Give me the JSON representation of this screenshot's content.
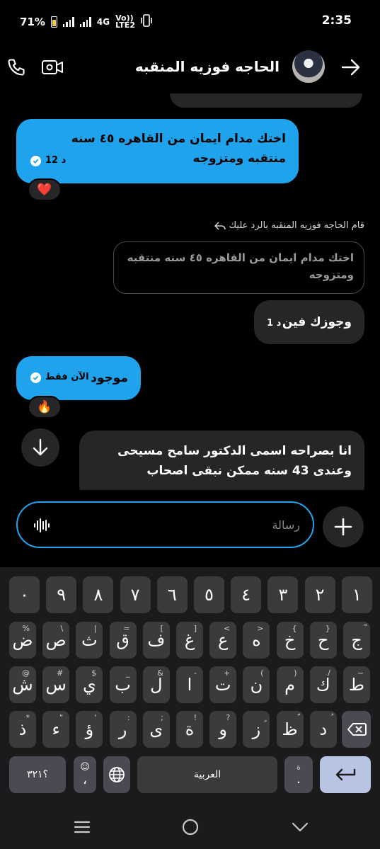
{
  "status_bar": {
    "battery": "71%",
    "network_label": "4G",
    "volte_line1": "Vo))",
    "volte_line2": "LTE2",
    "time": "2:35"
  },
  "header": {
    "contact_name": "الحاجه فوزيه المنقبه"
  },
  "messages": [
    {
      "direction": "outgoing",
      "text": "اختك مدام ايمان من القاهره ٤٥ سنه منتقبه ومتزوجه",
      "time": "12 د",
      "reaction": "❤️"
    },
    {
      "reply_label": "قام الحاجه فوزيه المنقبه بالرد عليك",
      "quoted": "اختك مدام ايمان من القاهره ٤٥ سنه منتقبه ومتزوجه"
    },
    {
      "direction": "incoming",
      "text": "وجوزك فين",
      "time": "1 د"
    },
    {
      "direction": "outgoing",
      "text": "موجود",
      "time": "الآن فقط",
      "reaction": "🔥"
    },
    {
      "direction": "incoming",
      "text": "انا بصراحه اسمى الدكتور سامح مسيحى وعندى 43 سنه ممكن نبقى اصحاب"
    }
  ],
  "composer": {
    "placeholder": "رسالة"
  },
  "keyboard": {
    "row1": [
      "١",
      "٢",
      "٣",
      "٤",
      "٥",
      "٦",
      "٧",
      "٨",
      "٩",
      "٠"
    ],
    "row2": [
      {
        "k": "ض",
        "s": "%"
      },
      {
        "k": "ص",
        "s": "\\"
      },
      {
        "k": "ث",
        "s": "|"
      },
      {
        "k": "ق",
        "s": "="
      },
      {
        "k": "ف",
        "s": "["
      },
      {
        "k": "غ",
        "s": "]"
      },
      {
        "k": "ع",
        "s": "<"
      },
      {
        "k": "ه",
        "s": ">"
      },
      {
        "k": "خ",
        "s": "{"
      },
      {
        "k": "ح",
        "s": "}"
      },
      {
        "k": "ج",
        "s": "ْ"
      }
    ],
    "row3": [
      {
        "k": "ش",
        "s": "@"
      },
      {
        "k": "س",
        "s": "#"
      },
      {
        "k": "ي",
        "s": "$"
      },
      {
        "k": "ب",
        "s": "_"
      },
      {
        "k": "ل",
        "s": "&"
      },
      {
        "k": "ا",
        "s": "-"
      },
      {
        "k": "ت",
        "s": "+"
      },
      {
        "k": "ن",
        "s": "("
      },
      {
        "k": "م",
        "s": ")"
      },
      {
        "k": "ك",
        "s": "/"
      },
      {
        "k": "ط",
        "s": "~"
      }
    ],
    "row4": [
      {
        "k": "ذ",
        "s": "*"
      },
      {
        "k": "ء",
        "s": "\""
      },
      {
        "k": "ؤ",
        "s": "'"
      },
      {
        "k": "ر",
        "s": ":"
      },
      {
        "k": "ى",
        "s": ";"
      },
      {
        "k": "ة",
        "s": "!"
      },
      {
        "k": "و",
        "s": "?"
      },
      {
        "k": "ز",
        "s": "ٍ"
      },
      {
        "k": "ظ",
        "s": "ّ"
      },
      {
        "k": "د",
        "s": "ُ"
      }
    ],
    "symbols_label": "؟٣٢١",
    "comma_label": "،",
    "space_label": "العربية",
    "period_label": "."
  }
}
